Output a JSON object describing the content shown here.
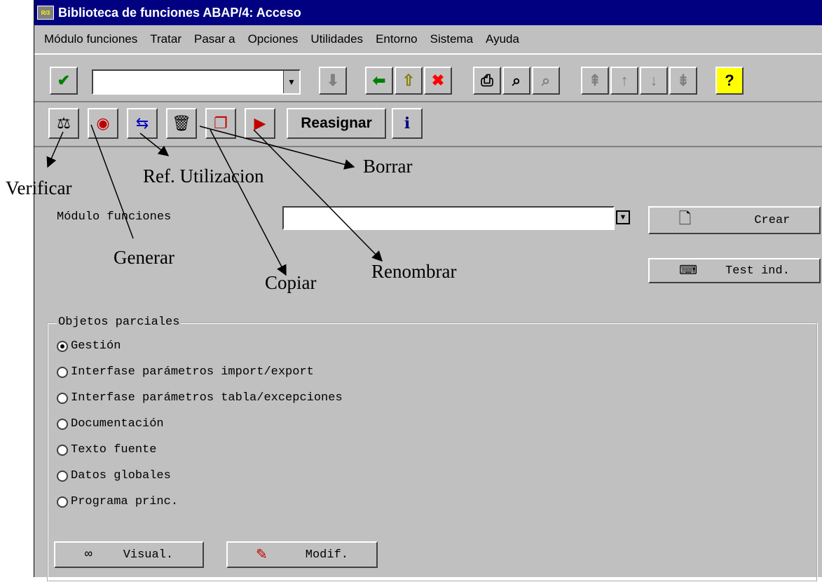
{
  "window": {
    "title": "Biblioteca de funciones ABAP/4: Acceso"
  },
  "menu": [
    "Módulo funciones",
    "Tratar",
    "Pasar a",
    "Opciones",
    "Utilidades",
    "Entorno",
    "Sistema",
    "Ayuda"
  ],
  "toolbar2": {
    "reasignar_label": "Reasignar"
  },
  "form": {
    "modulo_label": "Módulo funciones",
    "modulo_value": "",
    "crear_label": "Crear",
    "test_label": "Test ind."
  },
  "group": {
    "title": "Objetos parciales",
    "options": [
      {
        "label": "Gestión",
        "selected": true
      },
      {
        "label": "Interfase parámetros import/export",
        "selected": false
      },
      {
        "label": "Interfase parámetros tabla/excepciones",
        "selected": false
      },
      {
        "label": "Documentación",
        "selected": false
      },
      {
        "label": "Texto fuente",
        "selected": false
      },
      {
        "label": "Datos globales",
        "selected": false
      },
      {
        "label": "Programa princ.",
        "selected": false
      }
    ]
  },
  "bottom": {
    "visual_label": "Visual.",
    "modif_label": "Modif."
  },
  "annotations": {
    "verificar": "Verificar",
    "ref_utilizacion": "Ref. Utilizacion",
    "borrar": "Borrar",
    "generar": "Generar",
    "copiar": "Copiar",
    "renombrar": "Renombrar"
  },
  "colors": {
    "titlebar": "#000080",
    "window_bg": "#c0c0c0",
    "check_green": "#008000",
    "cancel_red": "#ff0000",
    "help_yellow": "#ffff00"
  },
  "icons": [
    "check-icon",
    "back-arrow-icon",
    "up-arrow-icon",
    "cancel-icon",
    "print-icon",
    "find-icon",
    "find-next-icon",
    "first-page-icon",
    "prev-page-icon",
    "next-page-icon",
    "last-page-icon",
    "help-icon",
    "verify-icon",
    "generate-icon",
    "where-used-icon",
    "delete-icon",
    "copy-icon",
    "rename-icon",
    "info-icon",
    "new-doc-icon",
    "test-icon",
    "glasses-icon",
    "pencil-icon"
  ]
}
